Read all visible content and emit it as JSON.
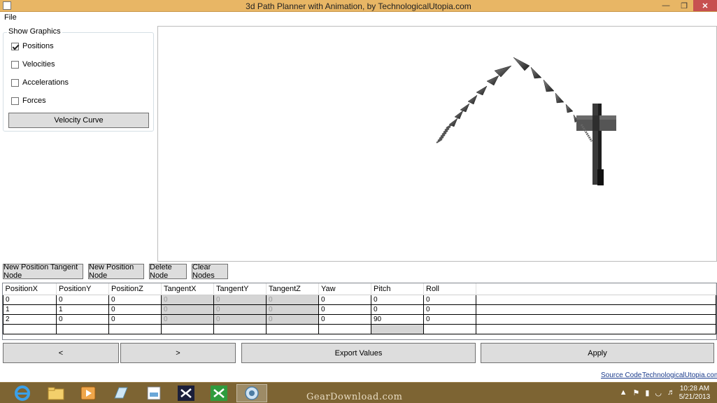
{
  "window": {
    "title": "3d Path Planner with Animation, by TechnologicalUtopia.com"
  },
  "menu": {
    "file": "File"
  },
  "show_graphics": {
    "title": "Show Graphics",
    "options": [
      {
        "label": "Positions",
        "checked": true
      },
      {
        "label": "Velocities",
        "checked": false
      },
      {
        "label": "Accelerations",
        "checked": false
      },
      {
        "label": "Forces",
        "checked": false
      }
    ],
    "velocity_curve": "Velocity Curve"
  },
  "node_buttons": {
    "new_tangent": "New Position Tangent Node",
    "new_position": "New Position Node",
    "delete": "Delete Node",
    "clear": "Clear Nodes"
  },
  "grid": {
    "columns": [
      "PositionX",
      "PositionY",
      "PositionZ",
      "TangentX",
      "TangentY",
      "TangentZ",
      "Yaw",
      "Pitch",
      "Roll"
    ],
    "rows": [
      [
        "0",
        "0",
        "0",
        "0",
        "0",
        "0",
        "0",
        "0",
        "0"
      ],
      [
        "1",
        "1",
        "0",
        "0",
        "0",
        "0",
        "0",
        "0",
        "0"
      ],
      [
        "2",
        "0",
        "0",
        "0",
        "0",
        "0",
        "0",
        "90",
        "0"
      ]
    ]
  },
  "bottom_buttons": {
    "prev": "<",
    "next": ">",
    "export": "Export Values",
    "apply": "Apply"
  },
  "links": {
    "source_code": "Source Code",
    "site": "TechnologicalUtopia.com"
  },
  "taskbar": {
    "watermark": "GearDownload.com",
    "clock_time": "10:28 AM",
    "clock_date": "5/21/2013"
  }
}
